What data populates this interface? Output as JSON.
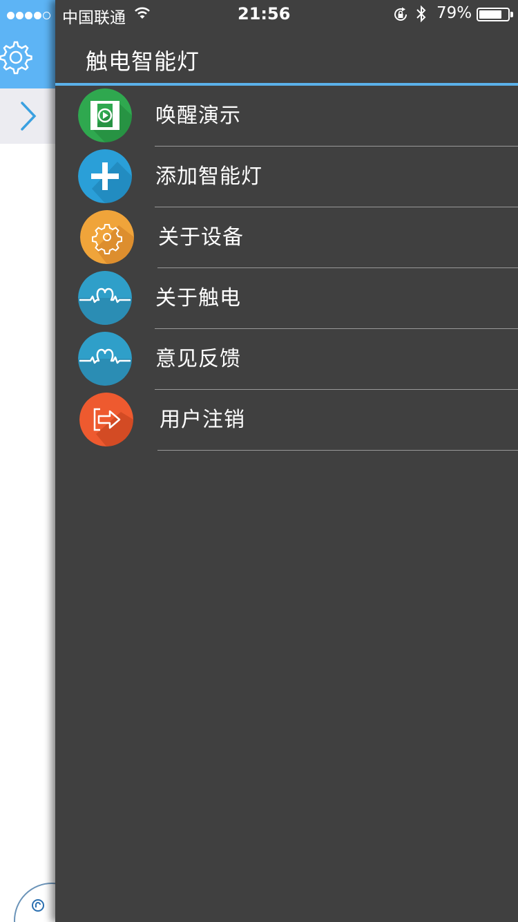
{
  "status_bar": {
    "carrier": "中国联通",
    "time": "21:56",
    "battery_percent": "79%",
    "battery_level": 0.79,
    "signal_bars_filled": 4,
    "signal_bars_total": 5
  },
  "drawer": {
    "title": "触电智能灯",
    "items": [
      {
        "label": "唤醒演示",
        "icon": "video-play-icon",
        "color": "#2fa84f"
      },
      {
        "label": "添加智能灯",
        "icon": "add-plus-icon",
        "color": "#2a9fd8"
      },
      {
        "label": "关于设备",
        "icon": "gear-icon",
        "color": "#f0a43a"
      },
      {
        "label": "关于触电",
        "icon": "heartbeat-icon",
        "color": "#2f9fc9"
      },
      {
        "label": "意见反馈",
        "icon": "heartbeat-icon",
        "color": "#2f9fc9"
      },
      {
        "label": "用户注销",
        "icon": "logout-icon",
        "color": "#ee5a2f"
      }
    ]
  },
  "colors": {
    "drawer_bg": "#404040",
    "accent": "#5bb1ea",
    "left_header": "#5db4f5"
  }
}
